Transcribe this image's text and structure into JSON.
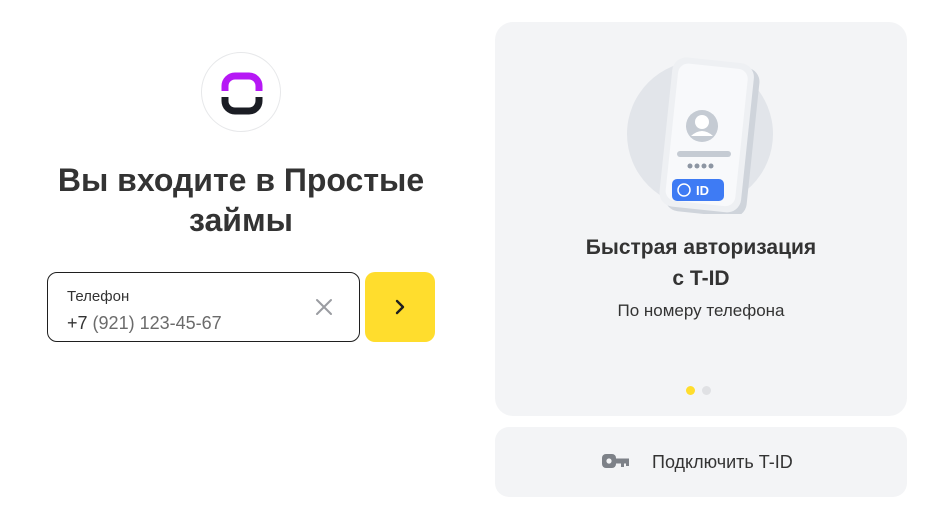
{
  "colors": {
    "accent_yellow": "#ffdd2d",
    "logo_purple": "#b618f5",
    "logo_dark": "#1b1d24",
    "card_bg": "#f3f4f6",
    "id_badge_blue": "#3e7bf4"
  },
  "logo": {
    "icon": "prostye-zaymy-logo-icon"
  },
  "login": {
    "title": "Вы входите в Простые займы",
    "phone_field": {
      "label": "Телефон",
      "prefix": "+7",
      "value": "(921) 123-45-67"
    },
    "clear_icon": "close-icon",
    "next_icon": "chevron-right-icon"
  },
  "tid_card": {
    "illustration_icon": "phone-id-illustration",
    "badge_text": "ID",
    "title_line1": "Быстрая авторизация",
    "title_line2": "с T-ID",
    "subtitle": "По номеру телефона",
    "carousel": {
      "pages": 2,
      "active_page": 1
    }
  },
  "connect_button": {
    "icon": "key-icon",
    "label": "Подключить T-ID"
  }
}
